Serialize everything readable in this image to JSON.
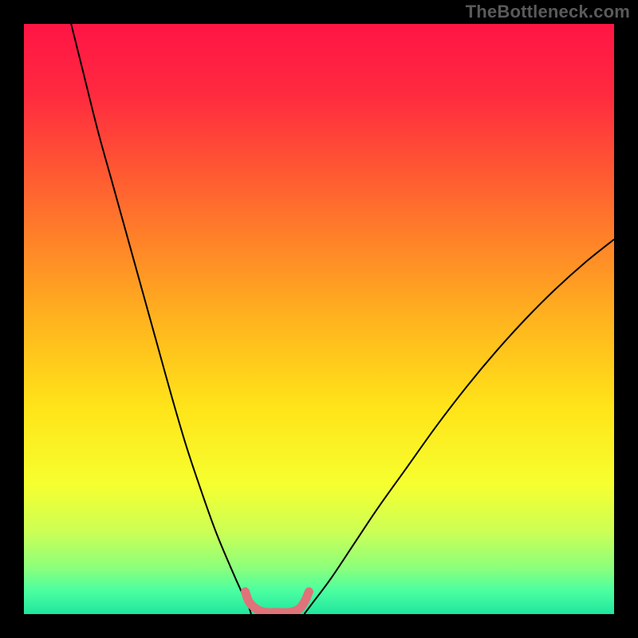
{
  "watermark": "TheBottleneck.com",
  "chart_data": {
    "type": "line",
    "title": "",
    "xlabel": "",
    "ylabel": "",
    "xlim": [
      0,
      100
    ],
    "ylim": [
      0,
      100
    ],
    "grid": false,
    "legend": null,
    "background_gradient": {
      "stops": [
        {
          "offset": 0.0,
          "color": "#ff1545"
        },
        {
          "offset": 0.12,
          "color": "#ff2a3f"
        },
        {
          "offset": 0.3,
          "color": "#ff6a2e"
        },
        {
          "offset": 0.5,
          "color": "#ffb31e"
        },
        {
          "offset": 0.65,
          "color": "#ffe419"
        },
        {
          "offset": 0.78,
          "color": "#f6ff2f"
        },
        {
          "offset": 0.86,
          "color": "#ccff55"
        },
        {
          "offset": 0.92,
          "color": "#8eff7a"
        },
        {
          "offset": 0.96,
          "color": "#4cffa0"
        },
        {
          "offset": 1.0,
          "color": "#20e69e"
        }
      ]
    },
    "series": [
      {
        "name": "left-curve",
        "color": "#000000",
        "width": 2,
        "x": [
          8.0,
          10.0,
          12.5,
          15.0,
          17.5,
          20.0,
          22.5,
          25.0,
          27.5,
          30.0,
          32.5,
          35.0,
          37.0,
          38.0,
          38.5
        ],
        "y": [
          100.0,
          92.0,
          82.0,
          73.0,
          64.0,
          55.0,
          46.0,
          37.0,
          28.5,
          21.0,
          14.0,
          8.0,
          3.5,
          1.5,
          0.0
        ]
      },
      {
        "name": "right-curve",
        "color": "#000000",
        "width": 2,
        "x": [
          47.5,
          49.0,
          52.0,
          56.0,
          60.0,
          65.0,
          70.0,
          75.0,
          80.0,
          85.0,
          90.0,
          95.0,
          100.0
        ],
        "y": [
          0.0,
          2.0,
          6.0,
          12.0,
          18.0,
          25.0,
          32.0,
          38.5,
          44.5,
          50.0,
          55.0,
          59.5,
          63.5
        ]
      },
      {
        "name": "bottom-pink",
        "color": "#e0727a",
        "width": 11,
        "linecap": "round",
        "x": [
          37.5,
          38.2,
          39.5,
          41.0,
          43.0,
          45.0,
          46.5,
          47.5,
          48.3
        ],
        "y": [
          3.8,
          2.0,
          0.8,
          0.3,
          0.3,
          0.3,
          0.8,
          2.0,
          3.8
        ]
      }
    ]
  }
}
